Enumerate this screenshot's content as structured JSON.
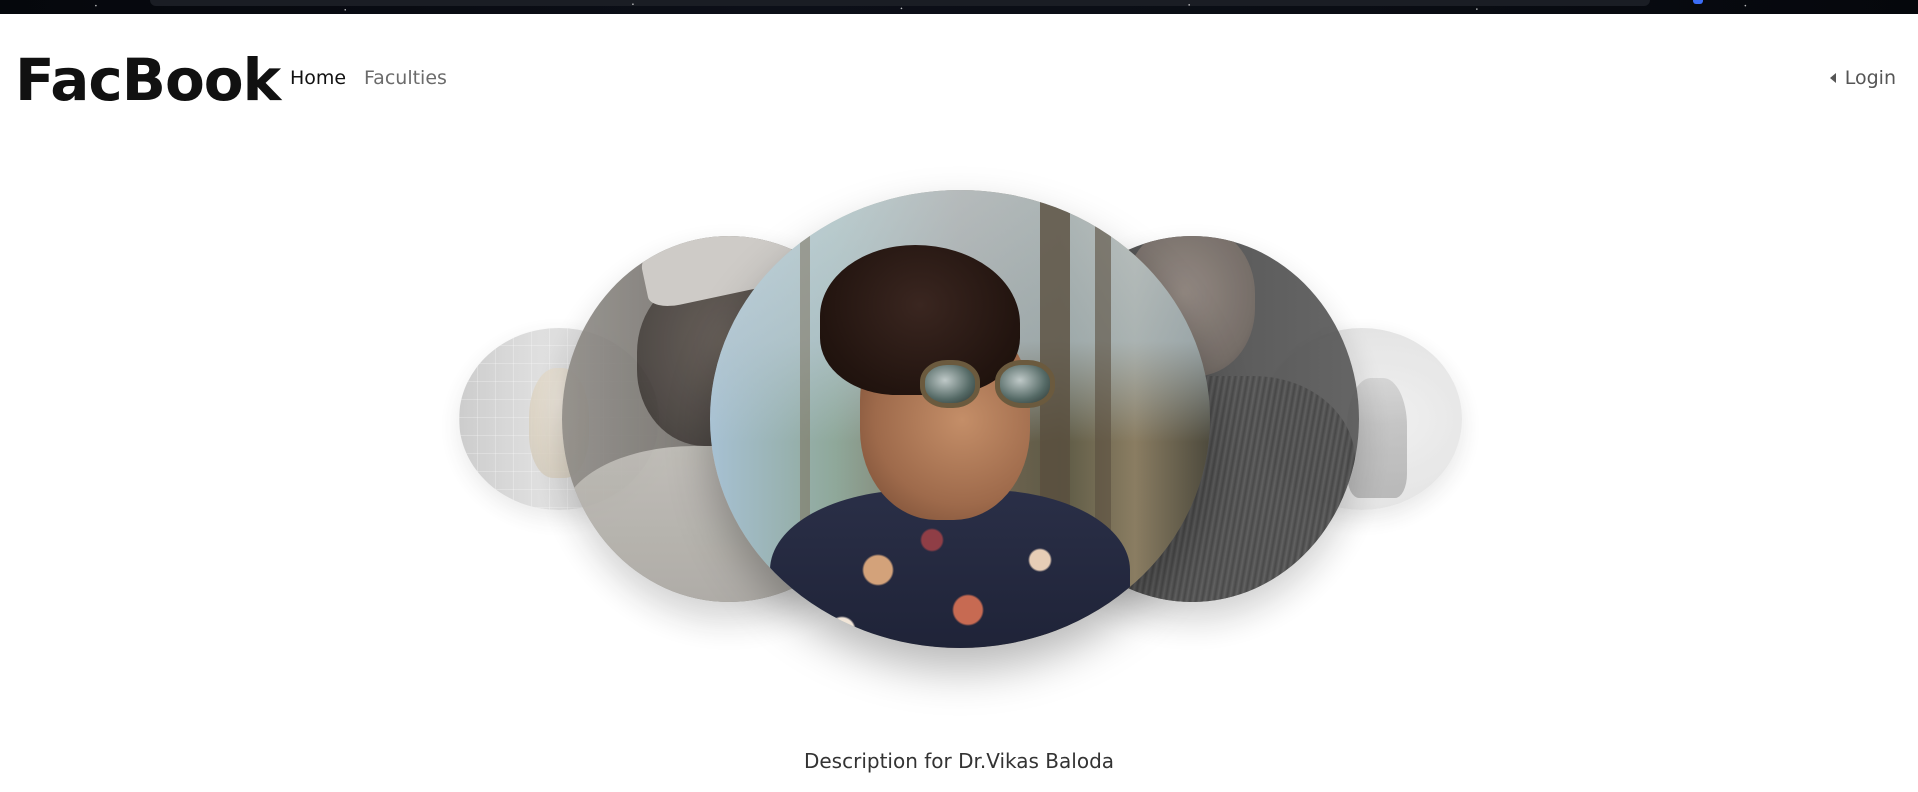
{
  "browser": {
    "accent_color": "#3b6cf5"
  },
  "navbar": {
    "brand": "FacBook",
    "links": [
      {
        "label": "Home",
        "active": true
      },
      {
        "label": "Faculties",
        "active": false
      }
    ],
    "login": {
      "label": "Login",
      "icon": "caret-left-icon"
    }
  },
  "carousel": {
    "slides": [
      {
        "position": "far-left",
        "photo": "woman-blonde-portrait"
      },
      {
        "position": "left",
        "photo": "man-turban-portrait"
      },
      {
        "position": "center",
        "photo": "man-sunglasses-portrait",
        "active": true
      },
      {
        "position": "right",
        "photo": "man-dark-shirt-portrait"
      },
      {
        "position": "far-right",
        "photo": "older-man-portrait"
      }
    ],
    "description": "Description for Dr.Vikas Baloda"
  },
  "colors": {
    "brand_text": "#111111",
    "active_link": "#111111",
    "inactive_link": "#6b6b6b",
    "login_text": "#555555",
    "background": "#ffffff"
  }
}
